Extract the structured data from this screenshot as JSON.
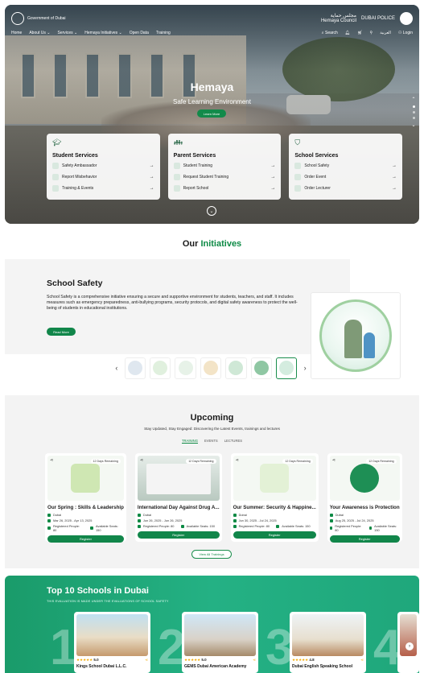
{
  "header": {
    "left_logo_text": "Government of Dubai",
    "right_logo_line1": "مجلس حماية",
    "right_logo_line2": "Hemaya Council",
    "right_police": "DUBAI POLICE",
    "nav_left": [
      "Home",
      "About Us ⌄",
      "Services ⌄",
      "Hemaya Initiatives ⌄",
      "Open Data",
      "Training"
    ],
    "nav_right": [
      "Search",
      "",
      "",
      "",
      "العربية",
      "Login"
    ]
  },
  "hero": {
    "title": "Hemaya",
    "subtitle": "Safe Learning Environment",
    "button": "Learn More",
    "services": [
      {
        "title": "Student Services",
        "icon": "graduation-cap-icon",
        "items": [
          "Safety Ambassador",
          "Report Misbehavior",
          "Training & Events"
        ]
      },
      {
        "title": "Parent Services",
        "icon": "parent-icon",
        "items": [
          "Student Training",
          "Request Student Training",
          "Report School"
        ]
      },
      {
        "title": "School Services",
        "icon": "shield-icon",
        "items": [
          "School Safety",
          "Order Event",
          "Order Lecturer"
        ]
      }
    ]
  },
  "initiatives": {
    "title_pre": "Our",
    "title_accent": "Initiatives",
    "heading": "School Safety",
    "body": "School Safety is a comprehensive initiative ensuring a secure and supportive environment for students, teachers, and staff. It includes measures such as emergency preparedness, anti-bullying programs, security protocols, and digital safety awareness to protect the well-being of students in educational institutions.",
    "button": "Read More"
  },
  "upcoming": {
    "title": "Upcoming",
    "subtitle": "Stay Updated, Stay Engaged: Discovering the Latest Events, trainings and lectures",
    "tabs": [
      "TRAINING",
      "EVENTS",
      "LECTURES"
    ],
    "cards": [
      {
        "badge": "12 Days Remaining",
        "title": "Our Spring : Skills & Leadership",
        "city": "Dubai",
        "dates": "Mar 26, 2025 - Apr 13, 2025",
        "reg": "Registered People: 80",
        "seats": "Available Seats: 150",
        "button": "Register"
      },
      {
        "badge": "12 Days Remaining",
        "title": "International Day Against Drug A...",
        "city": "Dubai",
        "dates": "Jun 26, 2025 - Jun 26, 2025",
        "reg": "Registered People: 80",
        "seats": "Available Seats: 150",
        "button": "Register"
      },
      {
        "badge": "12 Days Remaining",
        "title": "Our Summer: Security & Happine...",
        "city": "Dubai",
        "dates": "Jun 30, 2025 - Jul 24, 2025",
        "reg": "Registered People: 80",
        "seats": "Available Seats: 150",
        "button": "Register"
      },
      {
        "badge": "12 Days Remaining",
        "title": "Your Awareness is Protection",
        "city": "Dubai",
        "dates": "Aug 25, 2025 - Jul 24, 2025",
        "reg": "Registered People: 80",
        "seats": "Available Seats: 150",
        "button": "Register"
      }
    ],
    "view_all": "View All Trainings"
  },
  "top10": {
    "title": "Top 10 Schools in Dubai",
    "subtitle": "THIS EVALUATION IS MADE UNDER THE EVALUATIONS OF SCHOOL SAFETY",
    "schools": [
      {
        "rank": "1",
        "rating": "5.0",
        "name": "Kings School Dubai L.L.C."
      },
      {
        "rank": "2",
        "rating": "5.0",
        "name": "GEMS Dubai American Academy"
      },
      {
        "rank": "3",
        "rating": "4.8",
        "name": "Dubai English Speaking School"
      },
      {
        "rank": "4",
        "rating": "",
        "name": ""
      }
    ]
  },
  "colors": {
    "accent": "#0d8a45",
    "button": "#11864a",
    "top10_bg": "#1fa77b"
  }
}
